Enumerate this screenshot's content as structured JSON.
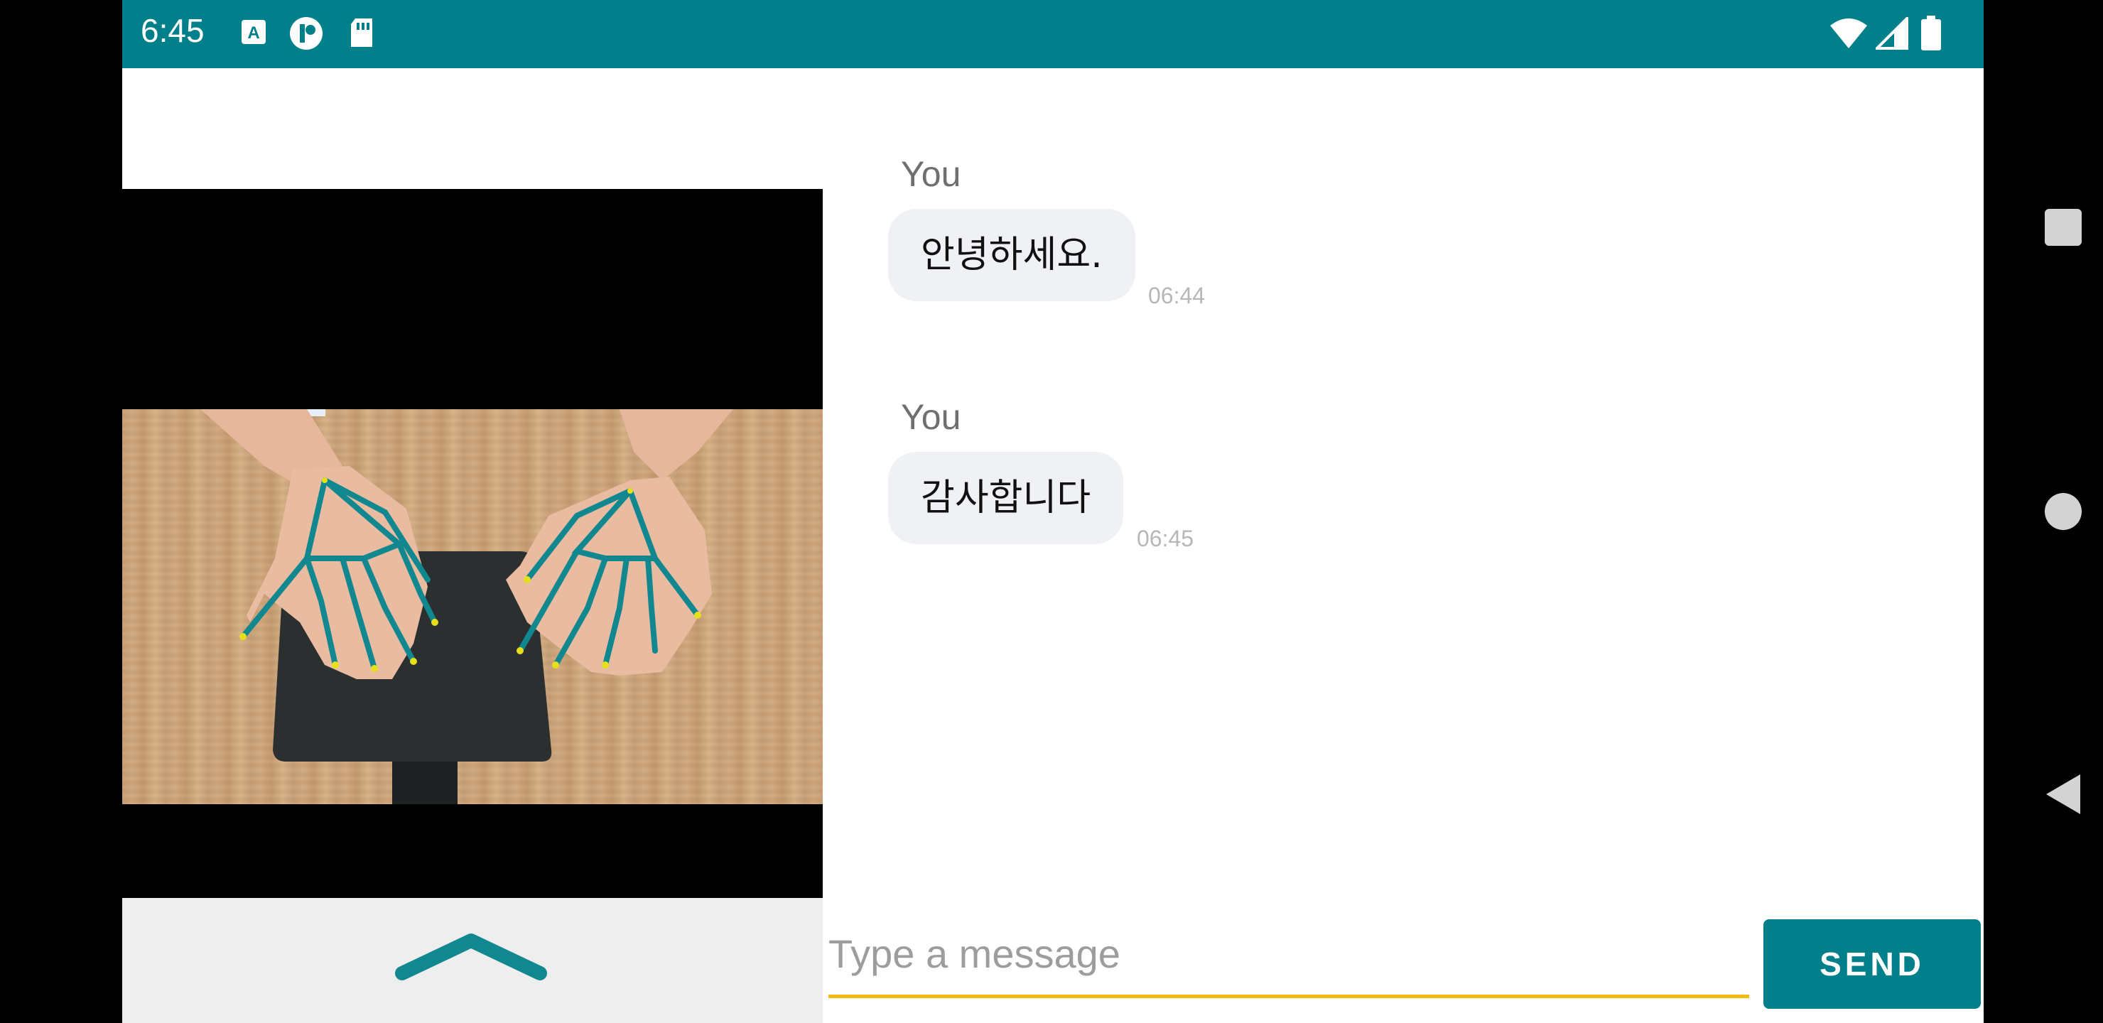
{
  "status_bar": {
    "time": "6:45",
    "icons": [
      "a-keyboard-icon",
      "circle-app-icon",
      "sd-card-icon",
      "wifi-icon",
      "signal-icon",
      "battery-icon"
    ]
  },
  "chat": {
    "messages": [
      {
        "sender": "You",
        "text": "안녕하세요.",
        "time": "06:44"
      },
      {
        "sender": "You",
        "text": "감사합니다",
        "time": "06:45"
      }
    ]
  },
  "composer": {
    "placeholder": "Type a message",
    "send_label": "SEND"
  },
  "nav": {
    "icons": [
      "recents-square-icon",
      "home-circle-icon",
      "back-triangle-icon"
    ]
  },
  "colors": {
    "accent": "#01808b",
    "underline": "#f2bb12",
    "bubble": "#eff1f4"
  }
}
